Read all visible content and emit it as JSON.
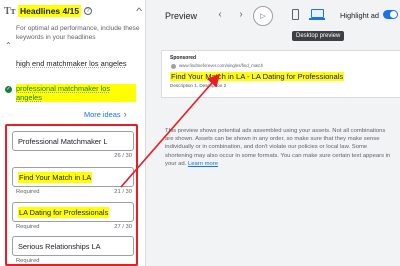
{
  "headlines": {
    "title": "Headlines 4/15",
    "tip": "For optimal ad performance, include these keywords in your headlines",
    "keywords": [
      "high end matchmaker los angeles",
      "professional matchmaker los angeles"
    ],
    "more_ideas": "More ideas",
    "fields": [
      {
        "value": "Professional Matchmaker L",
        "status": "",
        "count": "26 / 30"
      },
      {
        "value": "Find Your Match in LA",
        "status": "Required",
        "count": "21 / 30"
      },
      {
        "value": "LA Dating for Professionals",
        "status": "Required",
        "count": "27 / 30"
      },
      {
        "value": "Serious Relationships LA",
        "status": "Required",
        "count": ""
      }
    ]
  },
  "preview": {
    "title": "Preview",
    "highlight_label": "Highlight ad",
    "highlight_on": true,
    "tooltip": "Desktop preview",
    "ad": {
      "sponsored": "Sponsored",
      "url": "www.findmeforever.com/singles/find_match",
      "headline": "Find Your Match in LA - LA Dating for Professionals",
      "description": "Description 1. Description 2"
    },
    "disclaimer": "This preview shows potential ads assembled using your assets. Not all combinations are shown. Assets can be shown in any order, so make sure that they make sense individually or in combination, and don't violate our policies or local law. Some shortening may also occur in some formats. You can make sure certain text appears in your ad.",
    "learn_more": "Learn more"
  },
  "colors": {
    "highlight": "#ffff00",
    "annotation_red": "#ea1c24",
    "accent_blue": "#1a73e8"
  }
}
